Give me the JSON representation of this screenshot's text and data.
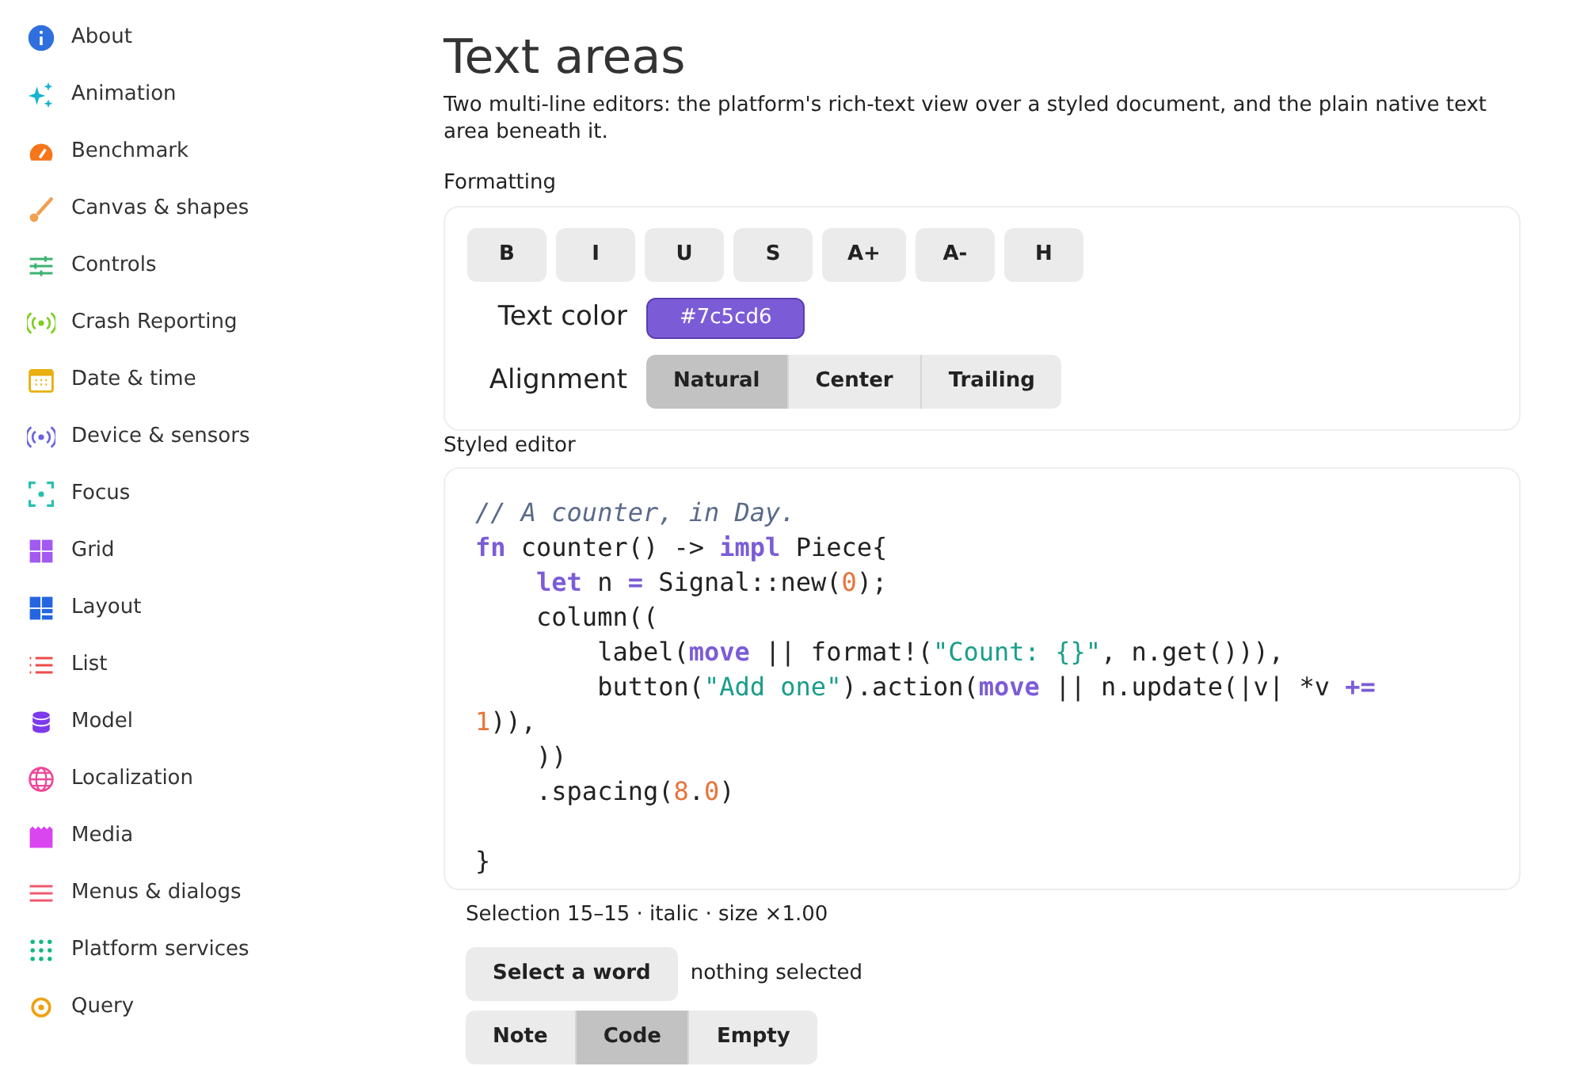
{
  "sidebar": {
    "items": [
      {
        "label": "About",
        "kind": "info",
        "color": "#2f6fde",
        "selected": false
      },
      {
        "label": "Animation",
        "kind": "sparkles",
        "color": "#17b3d0",
        "selected": false
      },
      {
        "label": "Benchmark",
        "kind": "gauge",
        "color": "#f5761a",
        "selected": false
      },
      {
        "label": "Canvas & shapes",
        "kind": "brush",
        "color": "#f0a050",
        "selected": false
      },
      {
        "label": "Controls",
        "kind": "sliders",
        "color": "#3cb371",
        "selected": false
      },
      {
        "label": "Crash Reporting",
        "kind": "broadcast",
        "color": "#7ccf1c",
        "selected": false
      },
      {
        "label": "Date & time",
        "kind": "calendar",
        "color": "#e8b010",
        "selected": false
      },
      {
        "label": "Device & sensors",
        "kind": "broadcast",
        "color": "#6a62e0",
        "selected": false
      },
      {
        "label": "Focus",
        "kind": "focus",
        "color": "#2bbfb0",
        "selected": false
      },
      {
        "label": "Grid",
        "kind": "grid",
        "color": "#a25af0",
        "selected": false
      },
      {
        "label": "Layout",
        "kind": "layout",
        "color": "#2566e0",
        "selected": false
      },
      {
        "label": "List",
        "kind": "list",
        "color": "#ee4b4b",
        "selected": false
      },
      {
        "label": "Model",
        "kind": "database",
        "color": "#7c3aed",
        "selected": false
      },
      {
        "label": "Localization",
        "kind": "globe",
        "color": "#ec4899",
        "selected": false
      },
      {
        "label": "Media",
        "kind": "film",
        "color": "#d946ef",
        "selected": false
      },
      {
        "label": "Menus & dialogs",
        "kind": "menu",
        "color": "#f05a6e",
        "selected": false
      },
      {
        "label": "Platform services",
        "kind": "dots",
        "color": "#10b981",
        "selected": false
      },
      {
        "label": "Query",
        "kind": "pin",
        "color": "#f0a010",
        "selected": false
      }
    ]
  },
  "page": {
    "title": "Text areas",
    "description": "Two multi-line editors: the platform's rich-text view over a styled document, and the plain native text area beneath it."
  },
  "formatting": {
    "label": "Formatting",
    "buttons": [
      "B",
      "I",
      "U",
      "S",
      "A+",
      "A-",
      "H"
    ],
    "text_color": {
      "label": "Text color",
      "value": "#7c5cd6",
      "color": "#7c5cd6"
    },
    "alignment": {
      "label": "Alignment",
      "options": [
        {
          "label": "Natural",
          "selected": true
        },
        {
          "label": "Center",
          "selected": false
        },
        {
          "label": "Trailing",
          "selected": false
        }
      ]
    }
  },
  "editor": {
    "label": "Styled editor",
    "lines": [
      {
        "kind": "code",
        "tokens": [
          {
            "kind": "comment",
            "text": "// A counter, in Day."
          }
        ]
      },
      {
        "kind": "code",
        "tokens": [
          {
            "kind": "keyword",
            "text": "fn"
          },
          {
            "kind": "plain",
            "text": " counter() -> "
          },
          {
            "kind": "keyword",
            "text": "impl"
          },
          {
            "kind": "plain",
            "text": " Piece{"
          }
        ]
      },
      {
        "kind": "code",
        "tokens": [
          {
            "kind": "keyword",
            "text": "    let"
          },
          {
            "kind": "plain",
            "text": " n "
          },
          {
            "kind": "keyword",
            "text": "="
          },
          {
            "kind": "plain",
            "text": " Signal::new("
          },
          {
            "kind": "number",
            "text": "0"
          },
          {
            "kind": "plain",
            "text": ");"
          }
        ]
      },
      {
        "kind": "code",
        "tokens": [
          {
            "kind": "plain",
            "text": "    column(("
          }
        ]
      },
      {
        "kind": "code",
        "tokens": [
          {
            "kind": "plain",
            "text": "        label("
          },
          {
            "kind": "keyword",
            "text": "move"
          },
          {
            "kind": "plain",
            "text": " || format!("
          },
          {
            "kind": "string",
            "text": "\"Count: {}\""
          },
          {
            "kind": "plain",
            "text": ", n.get())),"
          }
        ]
      },
      {
        "kind": "code",
        "tokens": [
          {
            "kind": "plain",
            "text": "        button("
          },
          {
            "kind": "string",
            "text": "\"Add one\""
          },
          {
            "kind": "plain",
            "text": ").action("
          },
          {
            "kind": "keyword",
            "text": "move"
          },
          {
            "kind": "plain",
            "text": " || n.update(|v| *v "
          },
          {
            "kind": "keyword",
            "text": "+="
          }
        ]
      },
      {
        "kind": "code",
        "tokens": [
          {
            "kind": "number",
            "text": "1"
          },
          {
            "kind": "plain",
            "text": ")),"
          }
        ]
      },
      {
        "kind": "code",
        "tokens": [
          {
            "kind": "plain",
            "text": "    ))"
          }
        ]
      },
      {
        "kind": "code",
        "tokens": [
          {
            "kind": "plain",
            "text": "    .spacing("
          },
          {
            "kind": "number",
            "text": "8"
          },
          {
            "kind": "plain",
            "text": "."
          },
          {
            "kind": "number",
            "text": "0"
          },
          {
            "kind": "plain",
            "text": ")"
          }
        ]
      },
      {
        "kind": "blank"
      },
      {
        "kind": "code",
        "tokens": [
          {
            "kind": "plain",
            "text": "}"
          }
        ]
      }
    ]
  },
  "selection_info": "Selection 15–15 · italic · size ×1.00",
  "select_word": {
    "button": "Select a word",
    "status": "nothing selected"
  },
  "document_picker": [
    {
      "label": "Note",
      "selected": false
    },
    {
      "label": "Code",
      "selected": true
    },
    {
      "label": "Empty",
      "selected": false
    }
  ]
}
